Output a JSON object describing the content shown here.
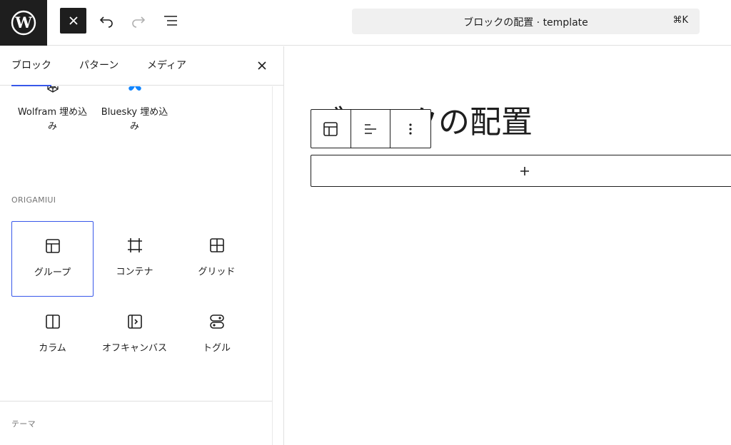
{
  "header": {
    "command_title": "ブロックの配置 · template",
    "shortcut": "⌘K"
  },
  "sidebar": {
    "tabs": [
      {
        "label": "ブロック"
      },
      {
        "label": "パターン"
      },
      {
        "label": "メディア"
      }
    ],
    "embed_blocks": [
      {
        "label": "Wolfram 埋め込み",
        "icon": "wolfram-icon"
      },
      {
        "label": "Bluesky 埋め込み",
        "icon": "bluesky-icon"
      }
    ],
    "section_origami": "ORIGAMIUI",
    "origami_blocks": [
      {
        "label": "グループ",
        "icon": "group-icon"
      },
      {
        "label": "コンテナ",
        "icon": "container-icon"
      },
      {
        "label": "グリッド",
        "icon": "grid-icon"
      },
      {
        "label": "カラム",
        "icon": "columns-icon"
      },
      {
        "label": "オフキャンバス",
        "icon": "offcanvas-icon"
      },
      {
        "label": "トグル",
        "icon": "toggle-icon"
      }
    ],
    "section_theme": "テーマ"
  },
  "canvas": {
    "page_title": "ブロックの配置"
  },
  "colors": {
    "accent": "#3858e9",
    "dark": "#1e1e1e",
    "bluesky": "#1185fe"
  }
}
